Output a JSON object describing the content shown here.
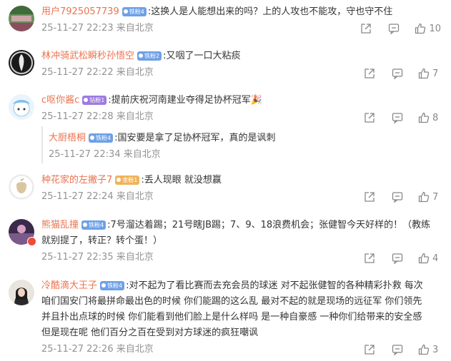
{
  "comments": [
    {
      "name": "用户7925057739",
      "badge": "铁粉4",
      "text": ":这换人是人能想出来的吗？上的人攻也不能攻，守也守不住",
      "time": "25-11-27 22:23 来自北京",
      "likes": "10"
    },
    {
      "name": "林冲骑武松瞬秒孙悟空",
      "badge": "铁粉2",
      "text": ":又咽了一口大粘痰",
      "time": "25-11-27 22:22 来自北京",
      "likes": "7"
    },
    {
      "name": "c呕你酱c",
      "badge": "钻粉1",
      "text": ":提前庆祝河南建业夺得足协杯冠军",
      "emoji": "🎉",
      "time": "25-11-27 22:28 来自北京",
      "likes": "8"
    },
    {
      "name": "种花家的左撇子7",
      "badge": "金粉1",
      "text": ":丢人现眼 就没想赢",
      "time": "25-11-27 22:24 来自北京",
      "likes": "7"
    },
    {
      "name": "熊猫乱撞",
      "badge": "铁粉4",
      "text_lines": [
        ":7号溜达着踢；21号瞎JB踢；7、9、18浪费机会；张健智今天好样的！（教练",
        "就别提了，转正？转个蛋！）"
      ],
      "time": "25-11-27 22:35 来自北京",
      "likes": "4"
    },
    {
      "name": "冷酷滴大王子",
      "badge": "铁粉4",
      "text_lines": [
        ":对不起为了看比赛而去充会员的球迷 对不起张健智的各种精彩扑救 每次",
        "咱们国安门将最拼命最出色的时候 你们能踢的这么乱 最对不起的就是现场的远征军 你们领先",
        "并且扑出点球的时候 你们能看到他们脸上是什么样吗 是一种自豪感 一种你们给带来的安全感",
        "但是现在呢 他们百分之百在受到对方球迷的疯狂嘲讽"
      ],
      "time": "25-11-27 22:26 来自北京",
      "likes": "3"
    }
  ],
  "reply": {
    "name": "大厨梧桐",
    "badge": "铁粉4",
    "text": ":国安要是拿了足协杯冠军，真的是讽刺",
    "time": "25-11-27 22:34 来自北京"
  }
}
